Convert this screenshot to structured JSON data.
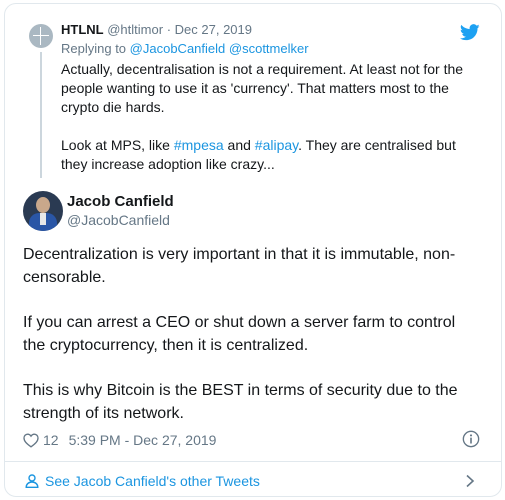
{
  "parent_tweet": {
    "name": "HTLNL",
    "handle": "@htltimor",
    "dot": "·",
    "date": "Dec 27, 2019",
    "replying_prefix": "Replying to",
    "replying_mention_1": "@JacobCanfield",
    "replying_mention_2": "@scottmelker",
    "line_1": "Actually, decentralisation is not a requirement. At least not for the",
    "line_2": "people wanting to use it as 'currency'. That matters most to the",
    "line_3": "crypto die hards.",
    "line_4_prefix": "Look at MPS, like ",
    "hashtag_1": "#mpesa",
    "line_4_mid": " and ",
    "hashtag_2": "#alipay",
    "line_4_suffix": ". They are centralised but",
    "line_5": "they increase adoption like crazy..."
  },
  "tweet": {
    "author_name": "Jacob Canfield",
    "author_handle": "@JacobCanfield",
    "para_1_line_1": "Decentralization is very important in that it is immutable, non-",
    "para_1_line_2": "censorable.",
    "para_2_line_1": "If you can arrest a CEO or shut down a server farm to control",
    "para_2_line_2": "the cryptocurrency, then it is centralized.",
    "para_3_line_1": "This is why Bitcoin is the BEST in terms of security due to the",
    "para_3_line_2": "strength of its network.",
    "likes": "12",
    "timestamp": "5:39 PM - Dec 27, 2019"
  },
  "footer": {
    "link_label": "See Jacob Canfield's other Tweets"
  },
  "colors": {
    "accent": "#1b95e0",
    "twitter_blue": "#1da1f2",
    "muted": "#657786",
    "text": "#14171a",
    "border": "#e1e8ed"
  },
  "icons": [
    "twitter-logo-icon",
    "heart-icon",
    "info-icon",
    "person-icon",
    "chevron-right-icon"
  ]
}
